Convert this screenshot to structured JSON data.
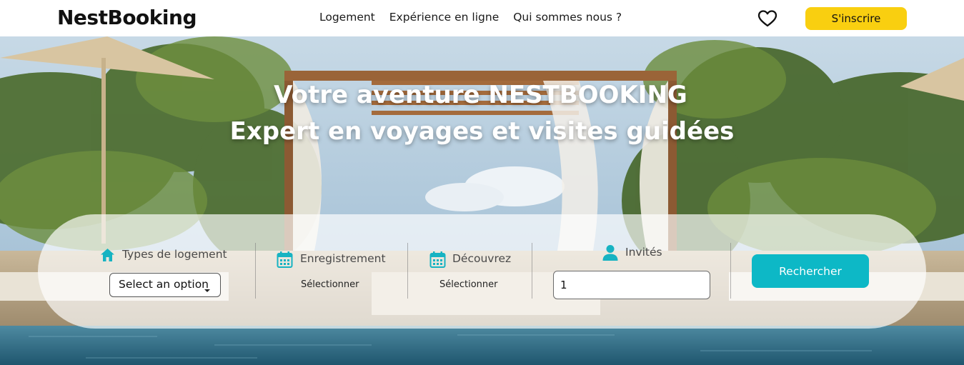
{
  "brand": {
    "logo_text": "NestBooking"
  },
  "nav": {
    "items": [
      {
        "label": "Logement"
      },
      {
        "label": "Expérience en ligne"
      },
      {
        "label": "Qui sommes nous ?"
      }
    ]
  },
  "header_actions": {
    "favorites_icon": "heart-icon",
    "signup_label": "S'inscrire"
  },
  "hero": {
    "title_line1": "Votre aventure NESTBOOKING",
    "title_line2": "Expert en voyages et visites guidées"
  },
  "search": {
    "types": {
      "label": "Types de logement",
      "icon": "home-icon",
      "selected": "Select an option"
    },
    "checkin": {
      "label": "Enregistrement",
      "icon": "calendar-icon",
      "value": "Sélectionner"
    },
    "discover": {
      "label": "Découvrez",
      "icon": "calendar-icon",
      "value": "Sélectionner"
    },
    "guests": {
      "label": "Invités",
      "icon": "person-icon",
      "value": "1"
    },
    "submit_label": "Rechercher"
  },
  "colors": {
    "accent_yellow": "#f9cf10",
    "accent_teal": "#0db8c6",
    "icon_teal": "#17b3c2"
  }
}
